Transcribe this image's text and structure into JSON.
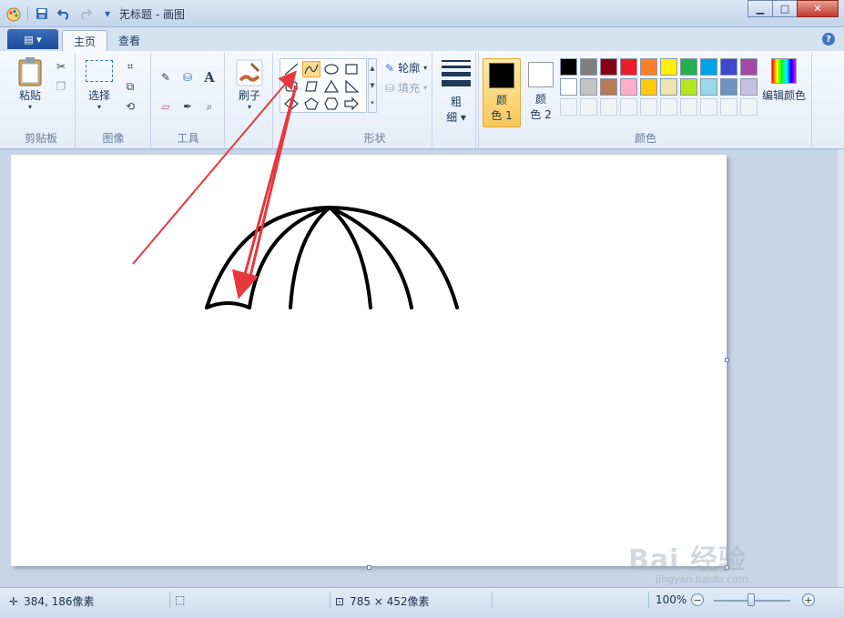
{
  "window": {
    "title": "无标题 - 画图"
  },
  "tabs": {
    "file": "▤ ▾",
    "home": "主页",
    "view": "查看"
  },
  "ribbon": {
    "clipboard": {
      "label": "剪贴板",
      "paste": "粘贴"
    },
    "image": {
      "label": "图像",
      "select": "选择"
    },
    "tools": {
      "label": "工具"
    },
    "brush": {
      "label": "刷子"
    },
    "shapes": {
      "label": "形状",
      "outline": "轮廓",
      "fill": "填充"
    },
    "size": {
      "label_line1": "粗",
      "label_line2": "细"
    },
    "colors": {
      "label": "颜色",
      "color1_line1": "颜",
      "color1_line2": "色 1",
      "color2_line1": "颜",
      "color2_line2": "色 2",
      "color1_value": "#000000",
      "color2_value": "#ffffff",
      "edit": "编辑颜色",
      "palette_row1": [
        "#000000",
        "#7f7f7f",
        "#880015",
        "#ed1c24",
        "#ff7f27",
        "#fff200",
        "#22b14c",
        "#00a2e8",
        "#3f48cc",
        "#a349a4"
      ],
      "palette_row2": [
        "#ffffff",
        "#c3c3c3",
        "#b97a57",
        "#ffaec9",
        "#ffc90e",
        "#efe4b0",
        "#b5e61d",
        "#99d9ea",
        "#7092be",
        "#c8bfe7"
      ]
    }
  },
  "status": {
    "cursor_pos": "384, 186像素",
    "canvas_size": "785 × 452像素",
    "zoom": "100%"
  },
  "watermark": {
    "brand": "Bai 经验",
    "url": "jingyan.baidu.com"
  },
  "accent": {
    "arrow_color": "#e8383d",
    "selected_tool": "#fbd98a"
  }
}
